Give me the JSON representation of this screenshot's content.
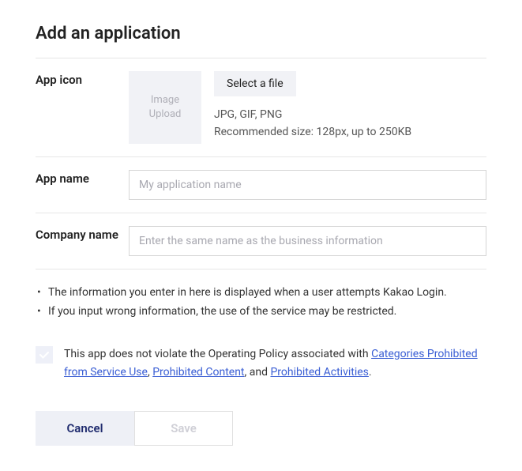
{
  "title": "Add an application",
  "rows": {
    "appIcon": {
      "label": "App icon",
      "uploadBox": "Image\nUpload",
      "selectButton": "Select a file",
      "hintFormats": "JPG, GIF, PNG",
      "hintSize": "Recommended size: 128px, up to 250KB"
    },
    "appName": {
      "label": "App name",
      "placeholder": "My application name",
      "value": ""
    },
    "companyName": {
      "label": "Company name",
      "placeholder": "Enter the same name as the business information",
      "value": ""
    }
  },
  "notes": [
    "The information you enter in here is displayed when a user attempts Kakao Login.",
    "If you input wrong information, the use of the service may be restricted."
  ],
  "consent": {
    "checked": false,
    "textPre": "This app does not violate the Operating Policy associated with ",
    "link1": "Categories Prohibited from Service Use",
    "sep1": ", ",
    "link2": "Prohibited Content",
    "sep2": ", and ",
    "link3": "Prohibited Activities",
    "textPost": "."
  },
  "actions": {
    "cancel": "Cancel",
    "save": "Save"
  }
}
